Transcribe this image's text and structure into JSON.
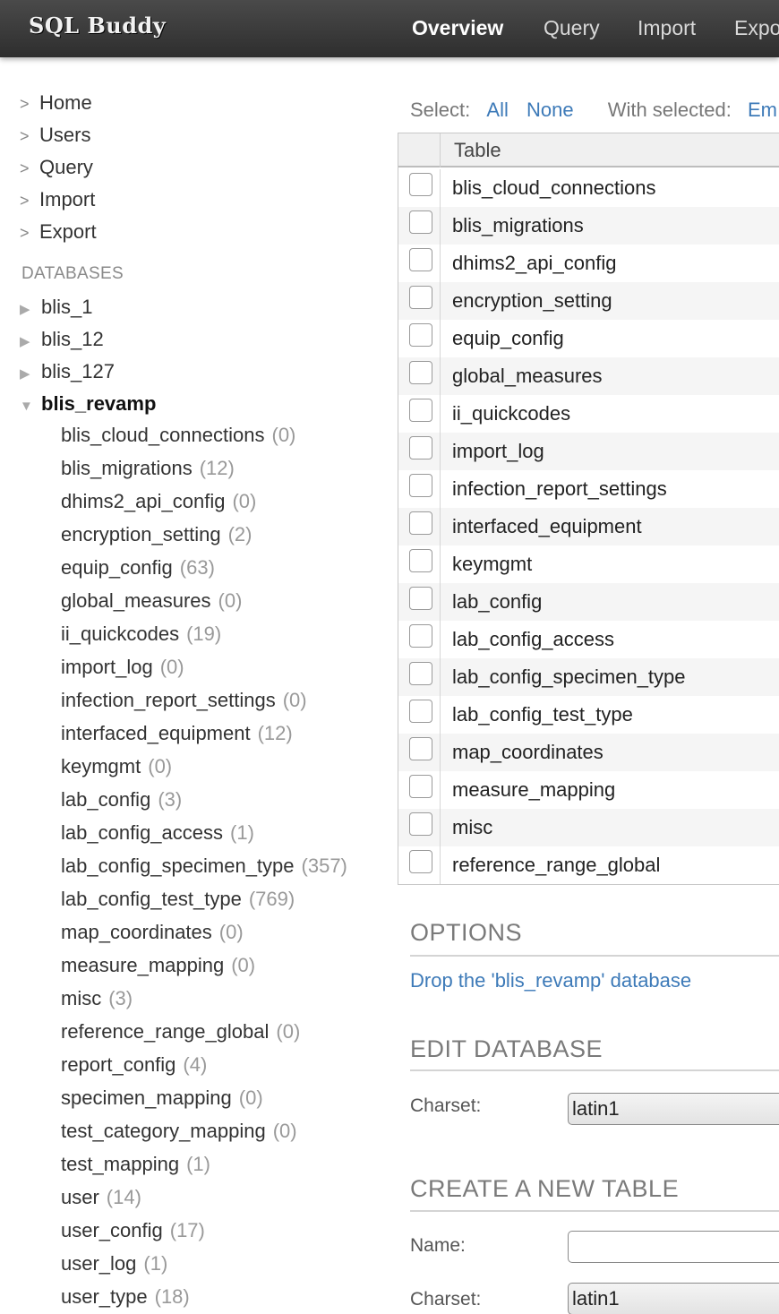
{
  "header": {
    "logo": "SQL Buddy",
    "nav": [
      "Overview",
      "Query",
      "Import",
      "Export"
    ]
  },
  "sidebar": {
    "menu": [
      "Home",
      "Users",
      "Query",
      "Import",
      "Export"
    ],
    "databases_heading": "DATABASES",
    "databases": [
      "blis_1",
      "blis_12",
      "blis_127",
      "blis_revamp"
    ],
    "tables": [
      {
        "name": "blis_cloud_connections",
        "count": "(0)"
      },
      {
        "name": "blis_migrations",
        "count": "(12)"
      },
      {
        "name": "dhims2_api_config",
        "count": "(0)"
      },
      {
        "name": "encryption_setting",
        "count": "(2)"
      },
      {
        "name": "equip_config",
        "count": "(63)"
      },
      {
        "name": "global_measures",
        "count": "(0)"
      },
      {
        "name": "ii_quickcodes",
        "count": "(19)"
      },
      {
        "name": "import_log",
        "count": "(0)"
      },
      {
        "name": "infection_report_settings",
        "count": "(0)"
      },
      {
        "name": "interfaced_equipment",
        "count": "(12)"
      },
      {
        "name": "keymgmt",
        "count": "(0)"
      },
      {
        "name": "lab_config",
        "count": "(3)"
      },
      {
        "name": "lab_config_access",
        "count": "(1)"
      },
      {
        "name": "lab_config_specimen_type",
        "count": "(357)"
      },
      {
        "name": "lab_config_test_type",
        "count": "(769)"
      },
      {
        "name": "map_coordinates",
        "count": "(0)"
      },
      {
        "name": "measure_mapping",
        "count": "(0)"
      },
      {
        "name": "misc",
        "count": "(3)"
      },
      {
        "name": "reference_range_global",
        "count": "(0)"
      },
      {
        "name": "report_config",
        "count": "(4)"
      },
      {
        "name": "specimen_mapping",
        "count": "(0)"
      },
      {
        "name": "test_category_mapping",
        "count": "(0)"
      },
      {
        "name": "test_mapping",
        "count": "(1)"
      },
      {
        "name": "user",
        "count": "(14)"
      },
      {
        "name": "user_config",
        "count": "(17)"
      },
      {
        "name": "user_log",
        "count": "(1)"
      },
      {
        "name": "user_type",
        "count": "(18)"
      }
    ]
  },
  "main": {
    "select_label": "Select:",
    "select_all": "All",
    "select_none": "None",
    "with_selected": "With selected:",
    "with_selected_action": "Em",
    "table_header": "Table",
    "rows": [
      "blis_cloud_connections",
      "blis_migrations",
      "dhims2_api_config",
      "encryption_setting",
      "equip_config",
      "global_measures",
      "ii_quickcodes",
      "import_log",
      "infection_report_settings",
      "interfaced_equipment",
      "keymgmt",
      "lab_config",
      "lab_config_access",
      "lab_config_specimen_type",
      "lab_config_test_type",
      "map_coordinates",
      "measure_mapping",
      "misc",
      "reference_range_global"
    ],
    "options_title": "OPTIONS",
    "drop_link": "Drop the 'blis_revamp' database",
    "edit_title": "EDIT DATABASE",
    "charset_label": "Charset:",
    "charset_value": "latin1",
    "create_title": "CREATE A NEW TABLE",
    "name_label": "Name:",
    "name_value": "",
    "create_charset_label": "Charset:",
    "create_charset_value": "latin1"
  },
  "colors": {
    "topbar": "#3a3a3a",
    "link": "#3d7ab8",
    "section_title": "#7a7a7a"
  }
}
